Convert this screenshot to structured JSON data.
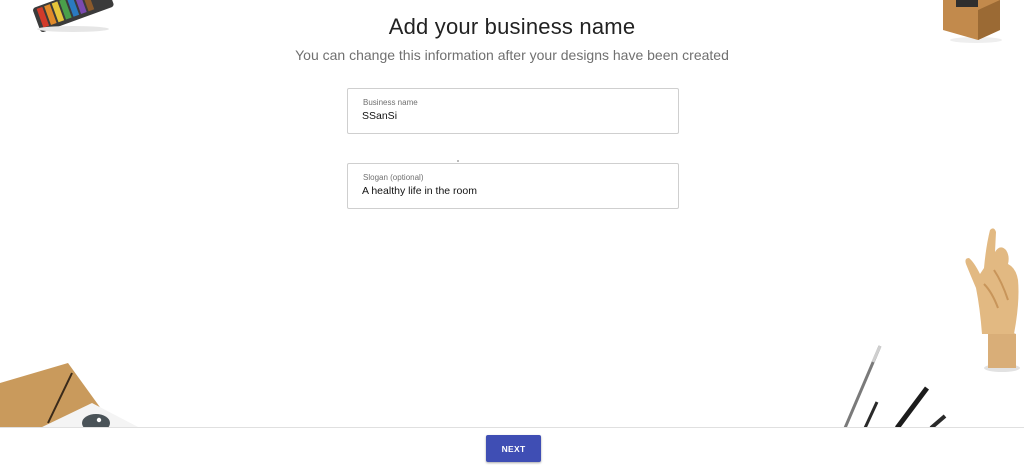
{
  "header": {
    "title": "Add your business name",
    "subtitle": "You can change this information after your designs have been created"
  },
  "form": {
    "business_name": {
      "label": "Business name",
      "value": "SSanSi"
    },
    "slogan": {
      "label": "Slogan (optional)",
      "value": "A healthy life in the room"
    }
  },
  "footer": {
    "next_label": "NEXT"
  },
  "colors": {
    "accent": "#3f4eb4"
  }
}
